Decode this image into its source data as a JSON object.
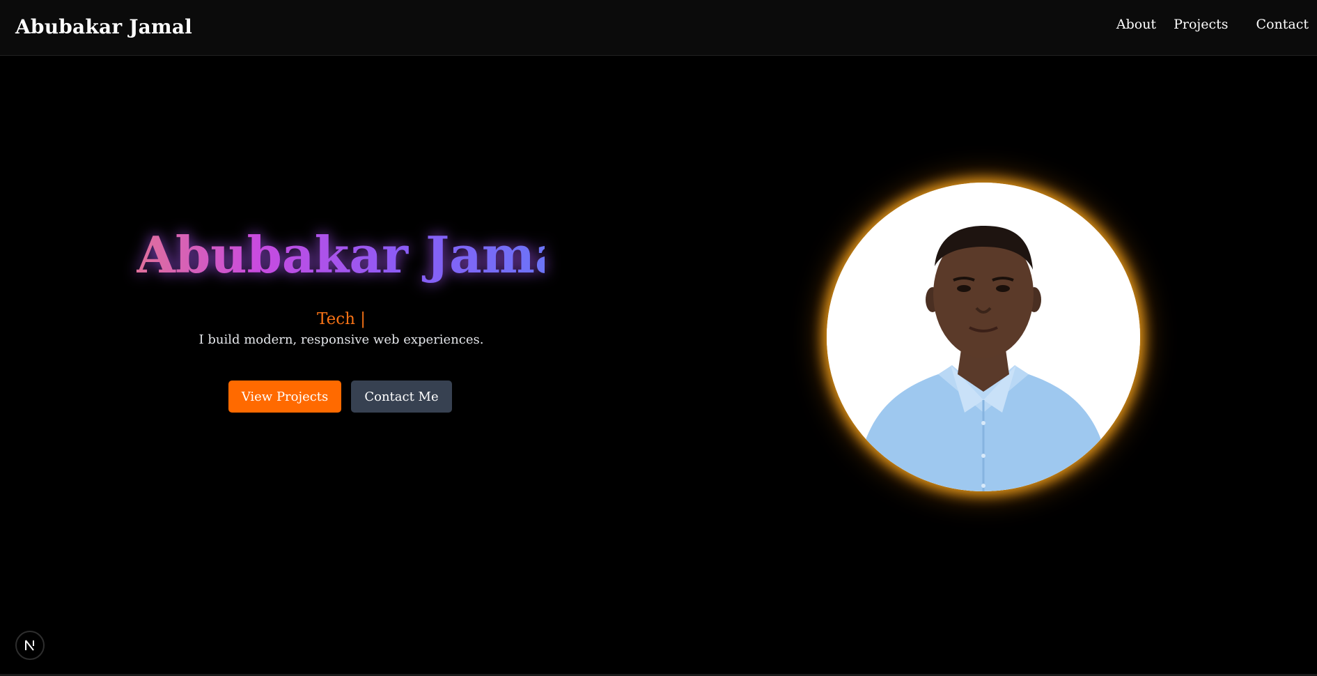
{
  "navbar": {
    "brand": "Abubakar Jamal",
    "links": [
      {
        "label": "About"
      },
      {
        "label": "Projects"
      },
      {
        "label": "Contact"
      }
    ]
  },
  "hero": {
    "name": "Abubakar Jamal",
    "typed_text": "Tech |",
    "tagline": "I build modern, responsive web experiences.",
    "primary_button": "View Projects",
    "secondary_button": "Contact Me"
  },
  "colors": {
    "accent_orange": "#ff6a00",
    "secondary_button": "#374151",
    "gradient_start": "#e0709a",
    "gradient_mid": "#c84be0",
    "gradient_end": "#6c74f7",
    "avatar_glow": "#ffaa1e"
  },
  "icons": {
    "dev_badge": "nextjs-icon"
  }
}
